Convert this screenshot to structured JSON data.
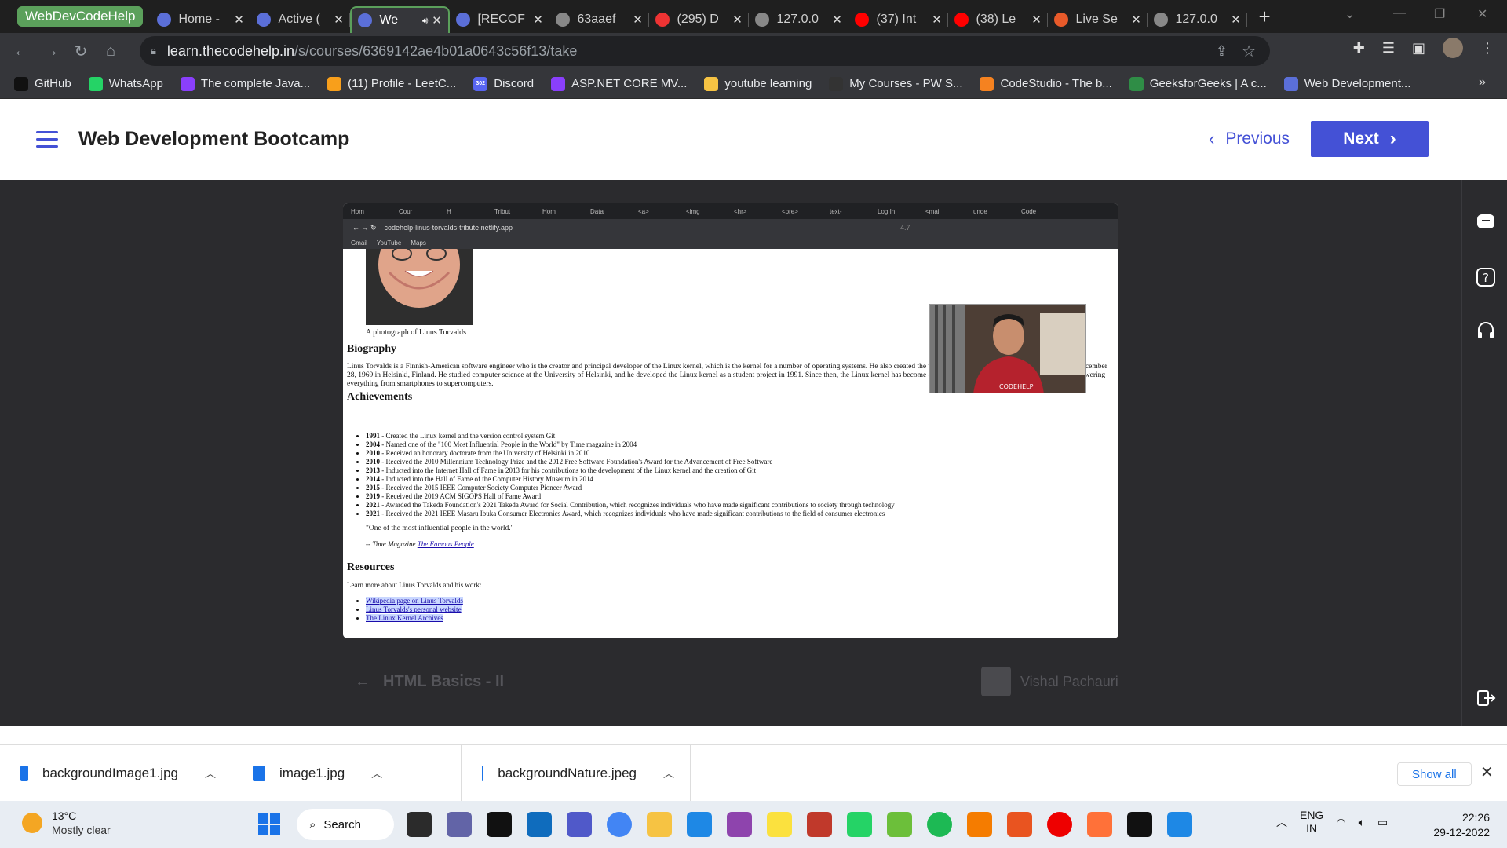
{
  "tabs": {
    "group_label": "WebDevCodeHelp",
    "items": [
      {
        "title": "Home -",
        "color": "#5b6fd8"
      },
      {
        "title": "Active (",
        "color": "#5b6fd8"
      },
      {
        "title": "We",
        "color": "#5b6fd8",
        "active": true
      },
      {
        "title": "[RECOF",
        "color": "#5b6fd8"
      },
      {
        "title": "63aaef",
        "color": "#888"
      },
      {
        "title": "(295) D",
        "color": "#e33"
      },
      {
        "title": "127.0.0",
        "color": "#888"
      },
      {
        "title": "(37) Int",
        "color": "#f00"
      },
      {
        "title": "(38) Le",
        "color": "#f00"
      },
      {
        "title": "Live Se",
        "color": "#e85a2a"
      },
      {
        "title": "127.0.0",
        "color": "#888"
      }
    ]
  },
  "toolbar": {
    "url_host": "learn.thecodehelp.in",
    "url_path": "/s/courses/6369142ae4b01a0643c56f13/take"
  },
  "bookmarks": [
    {
      "label": "GitHub",
      "color": "#111"
    },
    {
      "label": "WhatsApp",
      "color": "#25d366"
    },
    {
      "label": "The complete Java...",
      "color": "#8a3ffc"
    },
    {
      "label": "(11) Profile - LeetC...",
      "color": "#f89f1b"
    },
    {
      "label": "Discord",
      "color": "#5865f2",
      "badge": "302"
    },
    {
      "label": "ASP.NET CORE MV...",
      "color": "#8a3ffc"
    },
    {
      "label": "youtube learning",
      "color": "#f6c343"
    },
    {
      "label": "My Courses - PW S...",
      "color": "#333"
    },
    {
      "label": "CodeStudio - The b...",
      "color": "#f58220"
    },
    {
      "label": "GeeksforGeeks | A c...",
      "color": "#2f8d46"
    },
    {
      "label": "Web Development...",
      "color": "#5b6fd8"
    }
  ],
  "course": {
    "title": "Web Development Bootcamp",
    "previous_label": "Previous",
    "next_label": "Next"
  },
  "video": {
    "inner_tabs": [
      "Hom",
      "Cour",
      "H",
      "Tribut",
      "Hom",
      "Data",
      "<a>",
      "<img",
      "<hr>",
      "<pre>",
      "text-",
      "Log In",
      "<mai",
      "unde",
      "Code"
    ],
    "inner_url": "codehelp-linus-torvalds-tribute.netlify.app",
    "inner_zoom": "4.7",
    "inner_bookmarks": [
      "Gmail",
      "YouTube",
      "Maps"
    ],
    "caption": "A photograph of Linus Torvalds",
    "biography_heading": "Biography",
    "biography_text": "Linus Torvalds is a Finnish-American software engineer who is the creator and principal developer of the Linux kernel, which is the kernel for a number of operating systems. He also created the version control system Git. Torvalds was born on December 28, 1969 in Helsinki, Finland. He studied computer science at the University of Helsinki, and he developed the Linux kernel as a student project in 1991. Since then, the Linux kernel has become one of the most widely used kernels in the world, powering everything from smartphones to supercomputers.",
    "achievements_heading": "Achievements",
    "achievements": [
      {
        "year": "1991",
        "text": " - Created the Linux kernel and the version control system Git"
      },
      {
        "year": "2004",
        "text": " - Named one of the \"100 Most Influential People in the World\" by Time magazine in 2004"
      },
      {
        "year": "2010",
        "text": " - Received an honorary doctorate from the University of Helsinki in 2010"
      },
      {
        "year": "2010",
        "text": " - Received the 2010 Millennium Technology Prize and the 2012 Free Software Foundation's Award for the Advancement of Free Software"
      },
      {
        "year": "2013",
        "text": " - Inducted into the Internet Hall of Fame in 2013 for his contributions to the development of the Linux kernel and the creation of Git"
      },
      {
        "year": "2014",
        "text": " - Inducted into the Hall of Fame of the Computer History Museum in 2014"
      },
      {
        "year": "2015",
        "text": " - Received the 2015 IEEE Computer Society Computer Pioneer Award"
      },
      {
        "year": "2019",
        "text": " - Received the 2019 ACM SIGOPS Hall of Fame Award"
      },
      {
        "year": "2021",
        "text": " - Awarded the Takeda Foundation's 2021 Takeda Award for Social Contribution, which recognizes individuals who have made significant contributions to society through technology"
      },
      {
        "year": "2021",
        "text": " - Received the 2021 IEEE Masaru Ibuka Consumer Electronics Award, which recognizes individuals who have made significant contributions to the field of consumer electronics"
      }
    ],
    "quote": "\"One of the most influential people in the world.\"",
    "quote_source_prefix": "-- Time Magazine ",
    "quote_source_link": "The Famous People",
    "resources_heading": "Resources",
    "resources_intro": "Learn more about Linus Torvalds and his work:",
    "resources": [
      "Wikipedia page on Linus Torvalds",
      "Linus Torvalds's personal website",
      "The Linux Kernel Archives"
    ],
    "webcam_text": "CODEHELP"
  },
  "lesson_nav": {
    "prev_lesson": "HTML Basics - II",
    "author": "Vishal Pachauri"
  },
  "downloads": {
    "items": [
      "backgroundImage1.jpg",
      "image1.jpg",
      "backgroundNature.jpeg"
    ],
    "show_all": "Show all"
  },
  "taskbar": {
    "temp": "13°C",
    "weather": "Mostly clear",
    "search": "Search",
    "lang1": "ENG",
    "lang2": "IN",
    "time": "22:26",
    "date": "29-12-2022",
    "app_colors": [
      "#2b2b2b",
      "#6264a7",
      "#111",
      "#0f6cbd",
      "#5059c9",
      "#4285f4",
      "#f6c343",
      "#1e88e5",
      "#8e44ad",
      "#fbe13e",
      "#c0392b",
      "#25d366",
      "#6cbf3a",
      "#1db954",
      "#f57c00",
      "#e95420",
      "#e00",
      "#ff7139",
      "#111",
      "#1e88e5"
    ]
  }
}
